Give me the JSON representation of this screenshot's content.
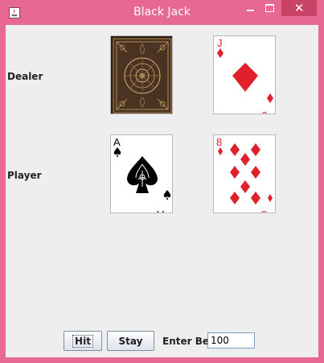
{
  "window": {
    "title": "Black Jack"
  },
  "table": {
    "dealer_label": "Dealer",
    "player_label": "Player",
    "dealer_cards": [
      {
        "face": "back"
      },
      {
        "rank": "J",
        "suit": "diamonds",
        "color": "#e0202a"
      }
    ],
    "player_cards": [
      {
        "rank": "A",
        "suit": "spades",
        "color": "#000000"
      },
      {
        "rank": "8",
        "suit": "diamonds",
        "color": "#e0202a"
      }
    ]
  },
  "controls": {
    "hit_label": "Hit",
    "stay_label": "Stay",
    "bet_label": "Enter Bet",
    "bet_value": "100"
  },
  "colors": {
    "frame": "#e66893",
    "close_button": "#c94367",
    "panel": "#eeeeee",
    "card_back": "#4a3322"
  }
}
